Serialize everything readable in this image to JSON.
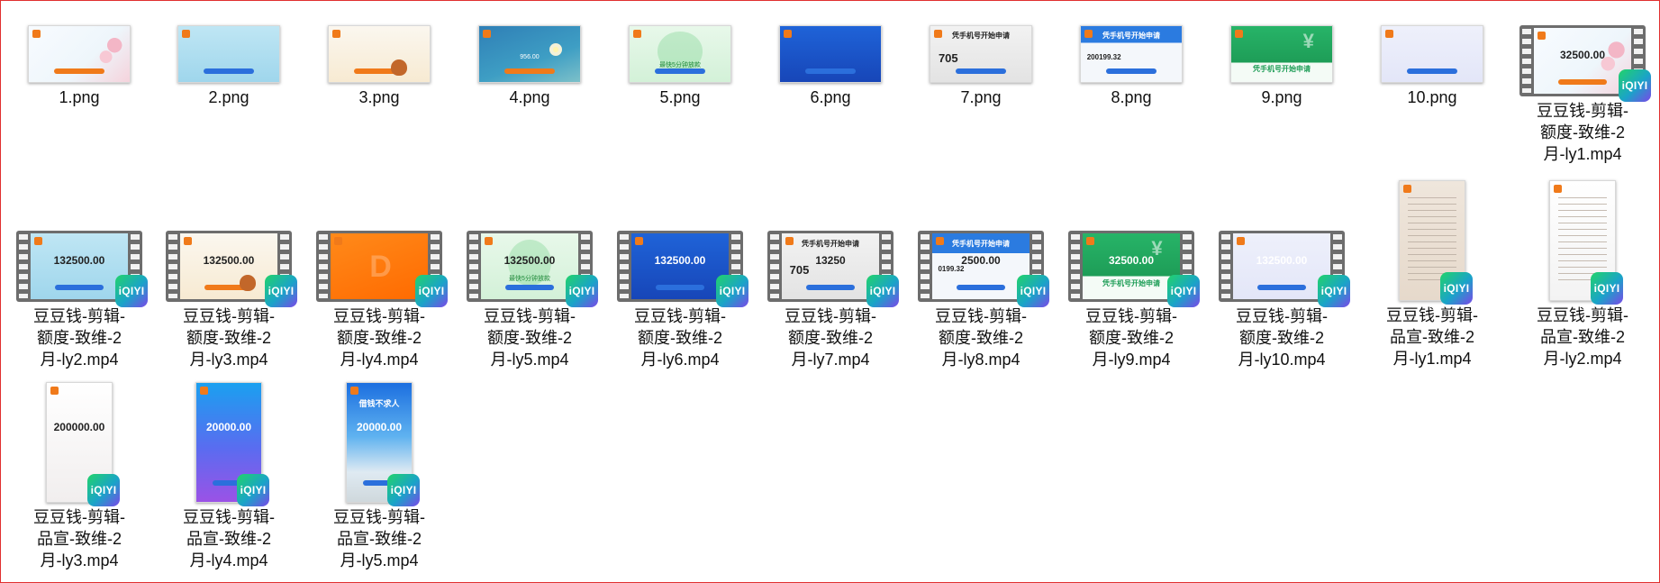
{
  "window": {
    "border_color": "#e03030"
  },
  "files": [
    {
      "name": "1.png",
      "kind": "image",
      "theme": "sakura",
      "badge": "iqiyi-icon"
    },
    {
      "name": "2.png",
      "kind": "image",
      "theme": "light-blue"
    },
    {
      "name": "3.png",
      "kind": "image",
      "theme": "money-bag"
    },
    {
      "name": "4.png",
      "kind": "image",
      "theme": "blue-flowers",
      "text": "956.00"
    },
    {
      "name": "5.png",
      "kind": "image",
      "theme": "green-circle",
      "text": "最快5分钟放款"
    },
    {
      "name": "6.png",
      "kind": "image",
      "theme": "blue-slider"
    },
    {
      "name": "7.png",
      "kind": "image",
      "theme": "gray-score",
      "title": "凭手机号开始申请",
      "score": "705"
    },
    {
      "name": "8.png",
      "kind": "image",
      "theme": "blue-form",
      "title": "凭手机号开始申请",
      "number": "200199.32"
    },
    {
      "name": "9.png",
      "kind": "image",
      "theme": "green-yen",
      "title": "凭手机号开始申请"
    },
    {
      "name": "10.png",
      "kind": "image",
      "theme": "purple-card"
    },
    {
      "name": "豆豆钱-剪辑-额度-致维-2月-ly1.mp4",
      "kind": "video",
      "theme": "sakura",
      "amount": "32500.00"
    },
    {
      "name": "豆豆钱-剪辑-额度-致维-2月-ly2.mp4",
      "kind": "video",
      "theme": "light-blue",
      "amount": "132500.00"
    },
    {
      "name": "豆豆钱-剪辑-额度-致维-2月-ly3.mp4",
      "kind": "video",
      "theme": "money-bag",
      "amount": "132500.00"
    },
    {
      "name": "豆豆钱-剪辑-额度-致维-2月-ly4.mp4",
      "kind": "video",
      "theme": "orange"
    },
    {
      "name": "豆豆钱-剪辑-额度-致维-2月-ly5.mp4",
      "kind": "video",
      "theme": "green-circle",
      "amount": "132500.00",
      "text": "最快5分钟放款"
    },
    {
      "name": "豆豆钱-剪辑-额度-致维-2月-ly6.mp4",
      "kind": "video",
      "theme": "blue-slider",
      "amount": "132500.00"
    },
    {
      "name": "豆豆钱-剪辑-额度-致维-2月-ly7.mp4",
      "kind": "video",
      "theme": "gray-score",
      "title": "凭手机号开始申请",
      "score": "705",
      "amount": "13250"
    },
    {
      "name": "豆豆钱-剪辑-额度-致维-2月-ly8.mp4",
      "kind": "video",
      "theme": "blue-form",
      "title": "凭手机号开始申请",
      "number": "0199.32",
      "amount": "2500.00"
    },
    {
      "name": "豆豆钱-剪辑-额度-致维-2月-ly9.mp4",
      "kind": "video",
      "theme": "green-yen",
      "title": "凭手机号开始申请",
      "amount": "32500.00"
    },
    {
      "name": "豆豆钱-剪辑-额度-致维-2月-ly10.mp4",
      "kind": "video",
      "theme": "purple-card",
      "amount": "132500.00"
    },
    {
      "name": "豆豆钱-剪辑-品宣-致维-2月-ly1.mp4",
      "kind": "video-portrait",
      "theme": "beige-doc"
    },
    {
      "name": "豆豆钱-剪辑-品宣-致维-2月-ly2.mp4",
      "kind": "video-portrait",
      "theme": "white-list"
    },
    {
      "name": "豆豆钱-剪辑-品宣-致维-2月-ly3.mp4",
      "kind": "video-portrait",
      "theme": "blurred",
      "amount": "200000.00"
    },
    {
      "name": "豆豆钱-剪辑-品宣-致维-2月-ly4.mp4",
      "kind": "video-portrait",
      "theme": "gradient-blue",
      "amount": "20000.00"
    },
    {
      "name": "豆豆钱-剪辑-品宣-致维-2月-ly5.mp4",
      "kind": "video-portrait",
      "theme": "sky-sea",
      "headline": "借钱不求人",
      "amount": "20000.00"
    }
  ],
  "badge_text": "iQIYI"
}
